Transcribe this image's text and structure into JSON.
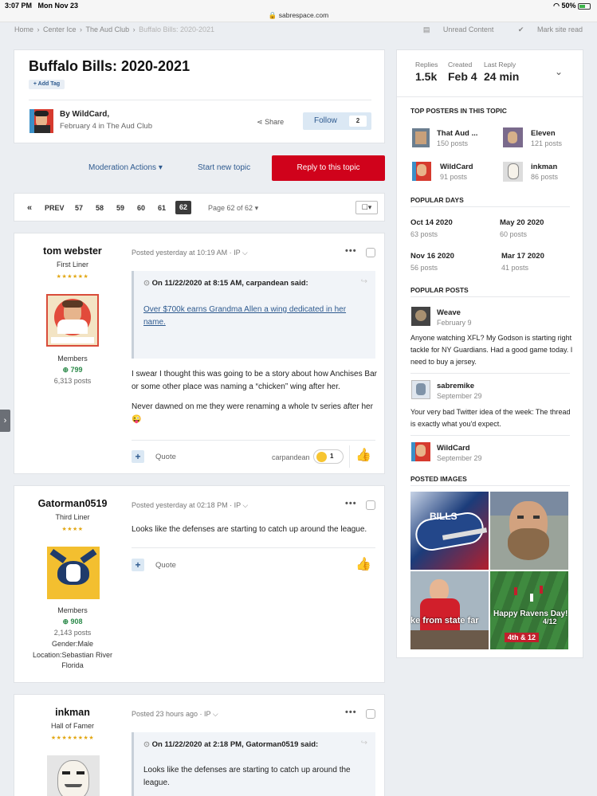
{
  "status_bar": {
    "time": "3:07 PM",
    "date": "Mon Nov 23",
    "battery": "50%"
  },
  "url": "sabrespace.com",
  "breadcrumb": [
    "Home",
    "Center Ice",
    "The Aud Club",
    "Buffalo Bills: 2020-2021"
  ],
  "top_links": {
    "unread": "Unread Content",
    "mark_read": "Mark site read"
  },
  "topic": {
    "title": "Buffalo Bills: 2020-2021",
    "add_tag": "Add Tag",
    "by": "By WildCard,",
    "date_line": "February 4 in The Aud Club",
    "share": "Share",
    "follow": "Follow",
    "follow_count": "2"
  },
  "actions": {
    "moderation": "Moderation Actions",
    "start_new": "Start new topic",
    "reply": "Reply to this topic"
  },
  "pagination": {
    "prev": "PREV",
    "pages": [
      "57",
      "58",
      "59",
      "60",
      "61"
    ],
    "current": "62",
    "page_of": "Page 62 of 62"
  },
  "posts": [
    {
      "author": "tom webster",
      "rank": "First Liner",
      "stars": "★★★★★★",
      "group": "Members",
      "reputation": "799",
      "post_count": "6,313 posts",
      "posted": "Posted yesterday at 10:19 AM · IP",
      "quote_head": "On 11/22/2020 at 8:15 AM, carpandean said:",
      "quote_link": "Over $700k earns Grandma Allen a wing dedicated in her name.",
      "text1": "I swear I thought this was going to be a story about how Anchises Bar or some other place was naming a “chicken” wing after her.",
      "text2": "Never dawned on me they were renaming a whole tv series after her",
      "quote_label": "Quote",
      "reaction_user": "carpandean",
      "reaction_count": "1"
    },
    {
      "author": "Gatorman0519",
      "rank": "Third Liner",
      "stars": "★★★★",
      "group": "Members",
      "reputation": "908",
      "post_count": "2,143 posts",
      "gender": "Gender:Male",
      "location": "Location:Sebastian River Florida",
      "posted": "Posted yesterday at 02:18 PM · IP",
      "text": "Looks like the defenses are starting to catch up around the league.",
      "quote_label": "Quote"
    },
    {
      "author": "inkman",
      "rank": "Hall of Famer",
      "stars": "★★★★★★★★",
      "posted": "Posted 23 hours ago · IP",
      "quote_head": "On 11/22/2020 at 2:18 PM, Gatorman0519 said:",
      "quote_body": "Looks like the defenses are starting to catch up around the league."
    }
  ],
  "sidebar": {
    "stats": [
      {
        "label": "Replies",
        "value": "1.5k"
      },
      {
        "label": "Created",
        "value": "Feb 4"
      },
      {
        "label": "Last Reply",
        "value": "24 min"
      }
    ],
    "top_posters_head": "TOP POSTERS IN THIS TOPIC",
    "top_posters": [
      {
        "name": "That Aud ...",
        "posts": "150 posts"
      },
      {
        "name": "Eleven",
        "posts": "121 posts"
      },
      {
        "name": "WildCard",
        "posts": "91 posts"
      },
      {
        "name": "inkman",
        "posts": "86 posts"
      }
    ],
    "popular_days_head": "POPULAR DAYS",
    "popular_days": [
      {
        "date": "Oct 14 2020",
        "posts": "63 posts"
      },
      {
        "date": "May 20 2020",
        "posts": "60 posts"
      },
      {
        "date": "Nov 16 2020",
        "posts": "56 posts"
      },
      {
        "date": "Mar 17 2020",
        "posts": "41 posts"
      }
    ],
    "popular_posts_head": "POPULAR POSTS",
    "popular_posts": [
      {
        "author": "Weave",
        "date": "February 9",
        "text": "Anyone watching XFL?  My Godson is starting right tackle for NY Guardians.  Had a good game today.  I need to buy a jersey."
      },
      {
        "author": "sabremike",
        "date": "September 29",
        "text": "Your very bad Twitter idea of the week: The thread is exactly what you'd expect."
      },
      {
        "author": "WildCard",
        "date": "September 29"
      }
    ],
    "posted_images_head": "POSTED IMAGES",
    "image_texts": {
      "bills": "BILLS",
      "state": "ke from state far",
      "ravens": "Happy Ravens Day!",
      "ravens_time": "4/12",
      "down": "4th & 12"
    }
  }
}
